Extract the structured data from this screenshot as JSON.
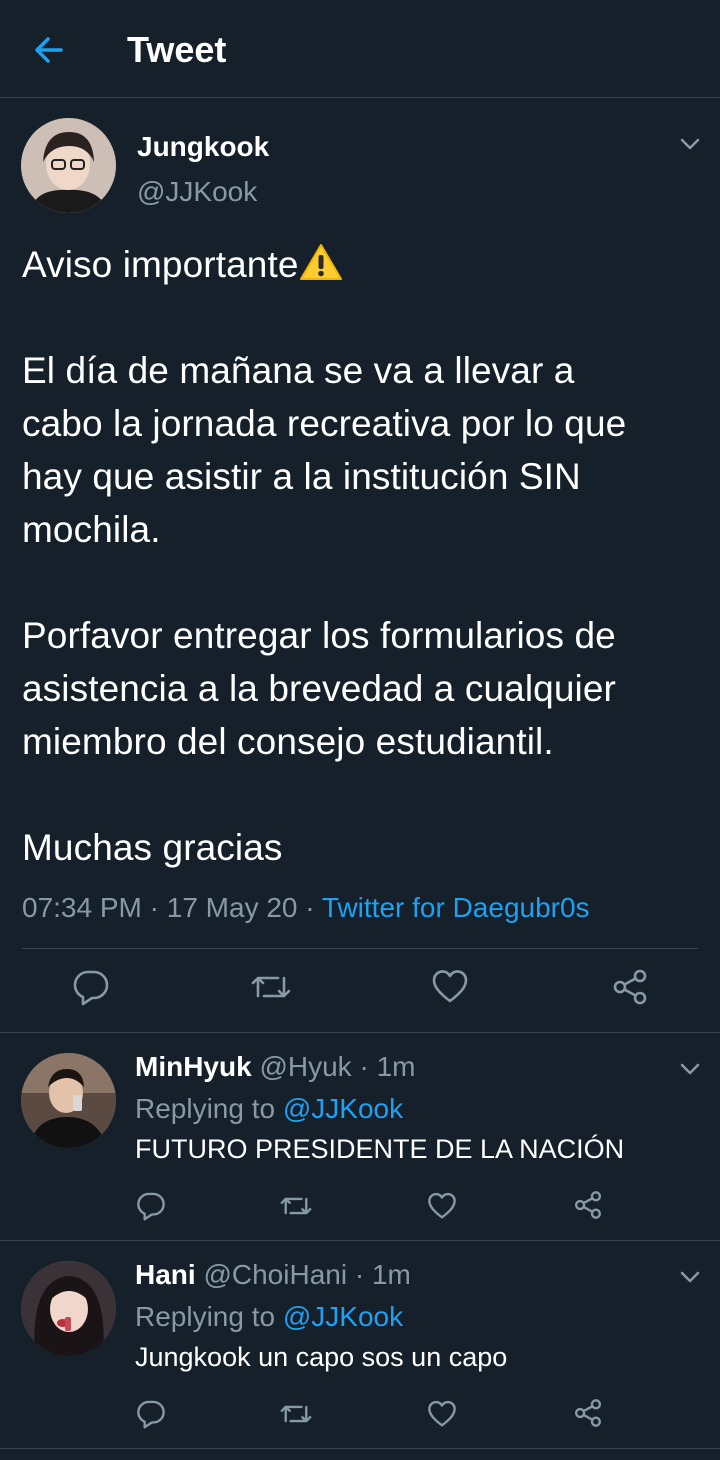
{
  "header": {
    "title": "Tweet"
  },
  "main_tweet": {
    "name": "Jungkook",
    "handle": "@JJKook",
    "text_line1": "Aviso importante",
    "warning_emoji": "⚠️",
    "text_rest": "\n\nEl día de mañana se va a llevar a\ncabo la jornada recreativa por lo que\nhay que asistir a la institución SIN\nmochila.\n\nPorfavor entregar los formularios de\nasistencia a la brevedad a cualquier\nmiembro del consejo estudiantil.\n\nMuchas gracias",
    "time": "07:34 PM",
    "date": "17 May 20",
    "source": "Twitter for Daegubr0s",
    "sep": "·"
  },
  "replies": [
    {
      "name": "MinHyuk",
      "handle": "@Hyuk",
      "time": "1m",
      "replying_prefix": "Replying to",
      "replying_handle": "@JJKook",
      "text": "FUTURO PRESIDENTE DE LA NACIÓN"
    },
    {
      "name": "Hani",
      "handle": "@ChoiHani",
      "time": "1m",
      "replying_prefix": "Replying to",
      "replying_handle": "@JJKook",
      "text": "Jungkook un capo sos un capo"
    }
  ],
  "colors": {
    "background": "#15202b",
    "accent": "#1da1f2",
    "secondary_text": "#8899a6",
    "divider": "#38444d"
  },
  "icons": [
    "back-arrow-icon",
    "chevron-down-icon",
    "reply-icon",
    "retweet-icon",
    "like-icon",
    "share-icon"
  ]
}
